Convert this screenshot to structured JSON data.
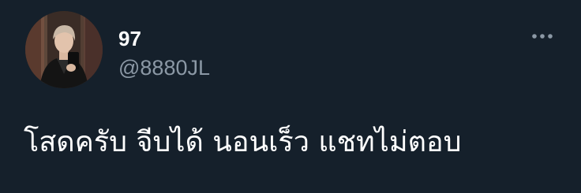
{
  "tweet": {
    "author": {
      "display_name": "97",
      "handle": "@8880JL",
      "avatar": "profile-photo"
    },
    "menu_icon": "more-horizontal-icon",
    "text": "โสดครับ จีบได้ นอนเร็ว แชทไม่ตอบ"
  },
  "colors": {
    "background": "#15202b",
    "primary_text": "#ffffff",
    "secondary_text": "#8b98a5"
  }
}
